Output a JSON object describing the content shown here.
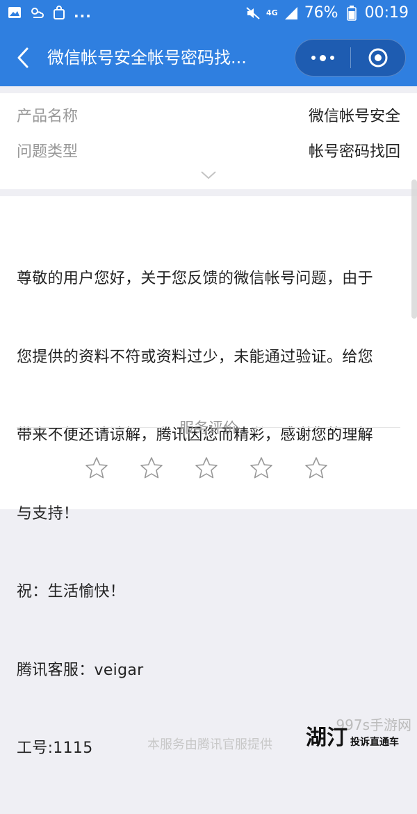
{
  "status_bar": {
    "more": "...",
    "network": "4G",
    "battery": "76%",
    "time": "00:19"
  },
  "nav": {
    "title": "微信帐号安全帐号密码找..."
  },
  "info": {
    "rows": [
      {
        "label": "产品名称",
        "value": "微信帐号安全"
      },
      {
        "label": "问题类型",
        "value": "帐号密码找回"
      }
    ]
  },
  "message": {
    "lines": [
      "尊敬的用户您好，关于您反馈的微信帐号问题，由于",
      "您提供的资料不符或资料过少，未能通过验证。给您",
      "带来不便还请谅解，腾讯因您而精彩，感谢您的理解",
      "与支持！",
      "祝：生活愉快！",
      "腾讯客服：veigar",
      "工号:1115"
    ]
  },
  "rating": {
    "title": "服务评价",
    "stars_total": 5,
    "stars_selected": 0
  },
  "footer": {
    "text": "本服务由腾讯官服提供",
    "watermark": "997s手游网",
    "badge_logo": "湖汀",
    "badge_text": "投诉直通车"
  },
  "colors": {
    "header": "#2f7fe0",
    "background": "#efeff4",
    "star_outline": "#999999"
  }
}
